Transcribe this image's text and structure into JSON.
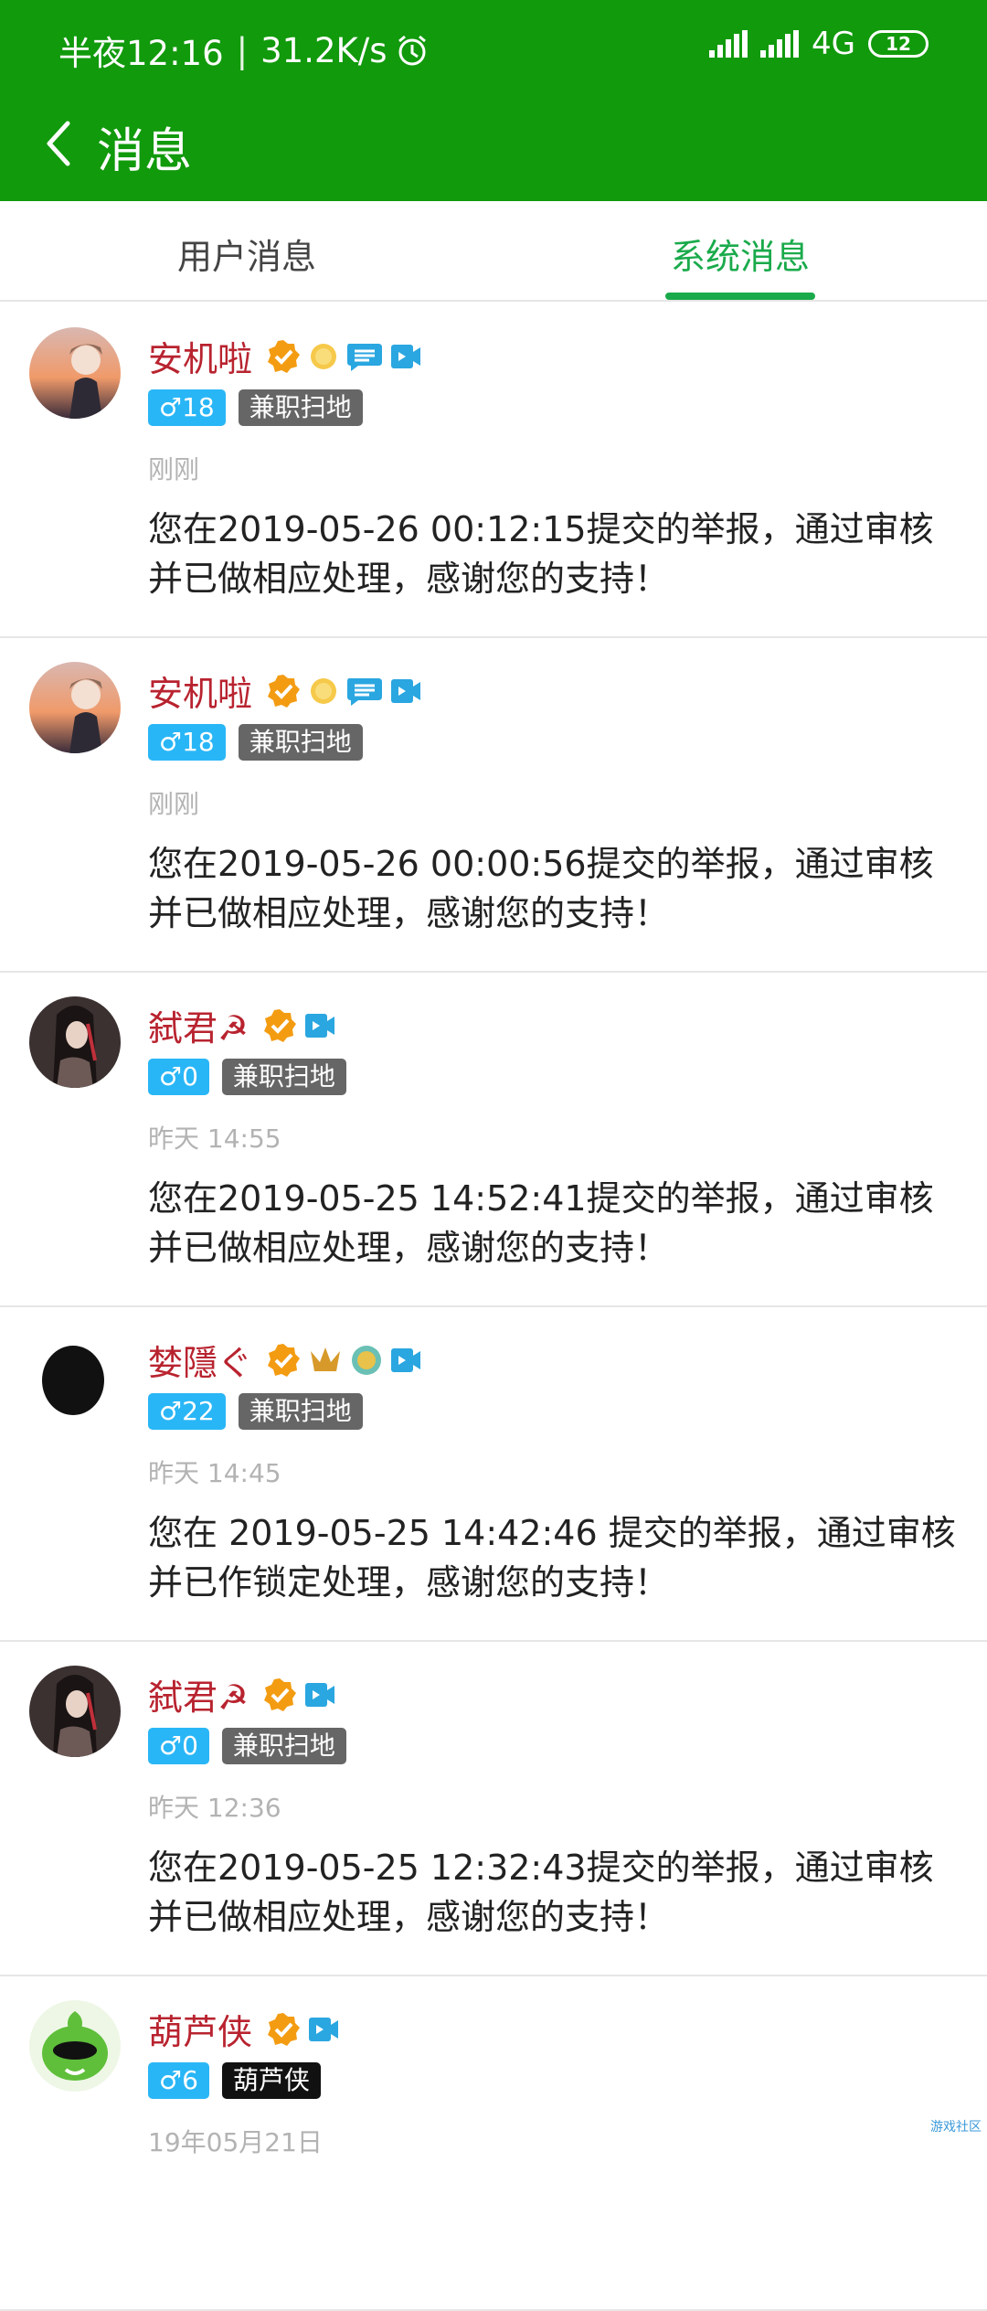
{
  "status_bar": {
    "time": "半夜12:16",
    "speed": "31.2K/s",
    "network": "4G",
    "battery": "12"
  },
  "header": {
    "title": "消息"
  },
  "tabs": [
    {
      "label": "用户消息",
      "active": false
    },
    {
      "label": "系统消息",
      "active": true
    }
  ],
  "colors": {
    "header": "#119a0c",
    "accent": "#1aaa4b",
    "username": "#b8232f",
    "gender_badge": "#29b6f6"
  },
  "messages": [
    {
      "name": "安机啦",
      "gender": "♂18",
      "role": "兼职扫地",
      "time": "刚刚",
      "text": "您在2019-05-26 00:12:15提交的举报，通过审核并已做相应处理，感谢您的支持！",
      "avatar": "avatar-anime-boy"
    },
    {
      "name": "安机啦",
      "gender": "♂18",
      "role": "兼职扫地",
      "time": "刚刚",
      "text": "您在2019-05-26 00:00:56提交的举报，通过审核并已做相应处理，感谢您的支持！",
      "avatar": "avatar-anime-boy"
    },
    {
      "name": "弑君☭",
      "gender": "♂0",
      "role": "兼职扫地",
      "time": "昨天 14:55",
      "text": "您在2019-05-25 14:52:41提交的举报，通过审核并已做相应处理，感谢您的支持！",
      "avatar": "avatar-dark-hair"
    },
    {
      "name": "婪隱ぐ",
      "gender": "♂22",
      "role": "兼职扫地",
      "time": "昨天 14:45",
      "text": "您在 2019-05-25 14:42:46 提交的举报，通过审核并已作锁定处理，感谢您的支持！",
      "avatar": "avatar-black-circle"
    },
    {
      "name": "弑君☭",
      "gender": "♂0",
      "role": "兼职扫地",
      "time": "昨天 12:36",
      "text": "您在2019-05-25 12:32:43提交的举报，通过审核并已做相应处理，感谢您的支持！",
      "avatar": "avatar-dark-hair"
    },
    {
      "name": "葫芦侠",
      "gender": "♂6",
      "role": "葫芦侠",
      "time": "19年05月21日",
      "text": "",
      "avatar": "avatar-green-mascot"
    }
  ],
  "watermark": "游戏社区"
}
